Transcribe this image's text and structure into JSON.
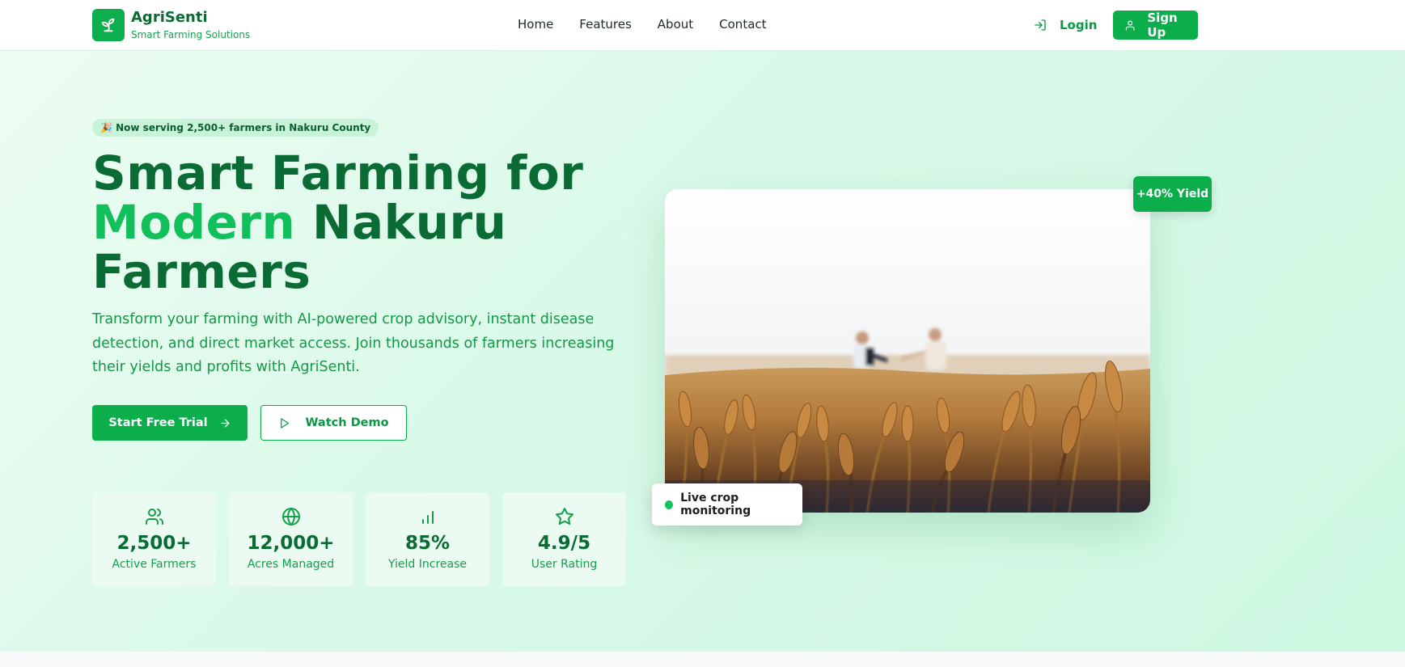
{
  "nav": {
    "brand_name": "AgriSenti",
    "brand_tagline": "Smart Farming Solutions",
    "links": [
      "Home",
      "Features",
      "About",
      "Contact"
    ],
    "login_label": "Login",
    "signup_label": "Sign Up"
  },
  "hero": {
    "badge": "🎉 Now serving 2,500+ farmers in Nakuru County",
    "title_line1": "Smart Farming for",
    "title_accent": "Modern",
    "title_line2_rest": " Nakuru",
    "title_line3": "Farmers",
    "description": "Transform your farming with AI-powered crop advisory, instant disease detection, and direct market access. Join thousands of farmers increasing their yields and profits with AgriSenti.",
    "cta_primary": "Start Free Trial",
    "cta_secondary": "Watch Demo"
  },
  "stats": [
    {
      "icon": "users-icon",
      "value": "2,500+",
      "label": "Active Farmers"
    },
    {
      "icon": "globe-icon",
      "value": "12,000+",
      "label": "Acres Managed"
    },
    {
      "icon": "bar-chart-icon",
      "value": "85%",
      "label": "Yield Increase"
    },
    {
      "icon": "star-icon",
      "value": "4.9/5",
      "label": "User Rating"
    }
  ],
  "image_card": {
    "yield_badge": "+40% Yield",
    "monitor_label": "Live crop monitoring"
  },
  "colors": {
    "brand_green": "#0cae4c",
    "dark_green": "#0a6b34",
    "accent_green": "#11c05a"
  }
}
